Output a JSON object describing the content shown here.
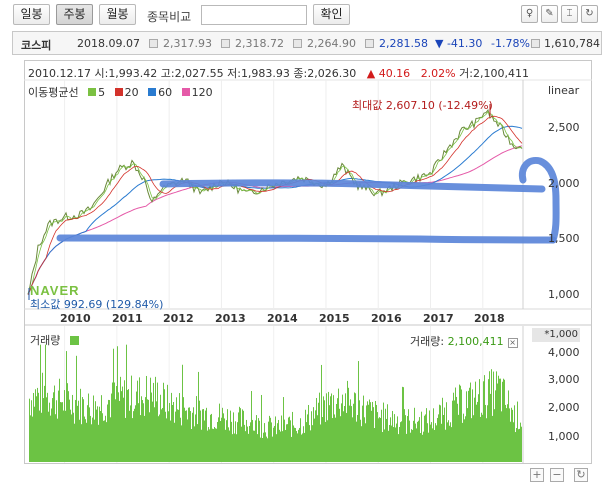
{
  "toolbar": {
    "btn_daily": "일봉",
    "btn_weekly": "주봉",
    "btn_monthly": "월봉",
    "compare_label": "종목비교",
    "compare_input_value": "",
    "confirm_label": "확인"
  },
  "infobar": {
    "name": "코스피",
    "date": "2018.09.07",
    "open": "2,317.93",
    "high": "2,318.72",
    "low": "2,264.90",
    "close": "2,281.58",
    "change": "▼ -41.30",
    "change_pct": "-1.78%",
    "volume": "1,610,784"
  },
  "ohlc": {
    "date": "2010.12.17",
    "open_label": "시:",
    "open": "1,993.42",
    "high_label": "고:",
    "high": "2,027.55",
    "low_label": "저:",
    "low": "1,983.93",
    "close_label": "종:",
    "close": "2,026.30",
    "change": "▲ 40.16",
    "change_pct": "2.02%",
    "volume_label": "거:",
    "volume": "2,100,411"
  },
  "legend": {
    "title": "이동평균선",
    "items": [
      {
        "label": "5",
        "color": "#7bc142"
      },
      {
        "label": "20",
        "color": "#d3322b"
      },
      {
        "label": "60",
        "color": "#2a7bd0"
      },
      {
        "label": "120",
        "color": "#e55aa8"
      }
    ]
  },
  "scale_mode": "linear",
  "watermark": "NAVER",
  "min_label": "최소값 992.69 (129.84%)",
  "max_label": "최대값 2,607.10 (-12.49%)",
  "volume_panel": {
    "title": "거래량",
    "value_label": "거래량:",
    "value": "2,100,411",
    "unit": "*1,000",
    "color": "#6cc344"
  },
  "chart_data": {
    "type": "line",
    "price_y_ticks": [
      "2,500",
      "2,000",
      "1,500",
      "1,000"
    ],
    "volume_y_ticks": [
      "4,000",
      "3,000",
      "2,000",
      "1,000"
    ],
    "x_ticks": [
      "2010",
      "2011",
      "2012",
      "2013",
      "2014",
      "2015",
      "2016",
      "2017",
      "2018"
    ],
    "price_ylim": [
      900,
      2700
    ],
    "volume_ylim": [
      0,
      4500
    ],
    "xlim": [
      2009.3,
      2018.75
    ],
    "price_series_approx": [
      [
        2009.3,
        1000
      ],
      [
        2009.5,
        1430
      ],
      [
        2009.7,
        1620
      ],
      [
        2010.0,
        1680
      ],
      [
        2010.3,
        1700
      ],
      [
        2010.5,
        1750
      ],
      [
        2010.8,
        1950
      ],
      [
        2011.0,
        2080
      ],
      [
        2011.3,
        2150
      ],
      [
        2011.55,
        1980
      ],
      [
        2011.65,
        1780
      ],
      [
        2011.8,
        1900
      ],
      [
        2012.0,
        1950
      ],
      [
        2012.3,
        2000
      ],
      [
        2012.6,
        1880
      ],
      [
        2013.0,
        1990
      ],
      [
        2013.5,
        1880
      ],
      [
        2014.0,
        1960
      ],
      [
        2014.5,
        2020
      ],
      [
        2015.0,
        1950
      ],
      [
        2015.3,
        2120
      ],
      [
        2015.6,
        1950
      ],
      [
        2016.0,
        1880
      ],
      [
        2016.5,
        1980
      ],
      [
        2017.0,
        2050
      ],
      [
        2017.3,
        2250
      ],
      [
        2017.6,
        2420
      ],
      [
        2017.9,
        2500
      ],
      [
        2018.05,
        2590
      ],
      [
        2018.3,
        2470
      ],
      [
        2018.5,
        2350
      ],
      [
        2018.6,
        2280
      ],
      [
        2018.69,
        2300
      ]
    ],
    "volume_series_approx": [
      [
        2009.3,
        2800
      ],
      [
        2009.6,
        3000
      ],
      [
        2010.0,
        2700
      ],
      [
        2010.5,
        2400
      ],
      [
        2011.0,
        2800
      ],
      [
        2011.7,
        3000
      ],
      [
        2012.0,
        2500
      ],
      [
        2012.5,
        2200
      ],
      [
        2013.0,
        2000
      ],
      [
        2014.0,
        1500
      ],
      [
        2014.5,
        1700
      ],
      [
        2015.0,
        2500
      ],
      [
        2015.3,
        2800
      ],
      [
        2016.0,
        2000
      ],
      [
        2016.5,
        1800
      ],
      [
        2017.0,
        1800
      ],
      [
        2017.5,
        2500
      ],
      [
        2018.0,
        2900
      ],
      [
        2018.3,
        3200
      ],
      [
        2018.6,
        2000
      ]
    ]
  }
}
